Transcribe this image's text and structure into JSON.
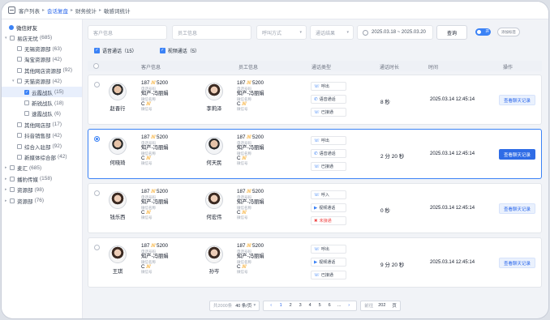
{
  "topnav": {
    "tabs": [
      "客户列表",
      "会话复盘",
      "财务统计",
      "敏感词统计"
    ],
    "active": 1
  },
  "sidebar": {
    "header": "微信好友",
    "items": [
      {
        "label": "易店无忧",
        "count": "(685)",
        "level": 0,
        "checked": false
      },
      {
        "label": "无锡资源部",
        "count": "(63)",
        "level": 1,
        "checked": false
      },
      {
        "label": "淘宝资源部",
        "count": "(42)",
        "level": 1,
        "checked": false
      },
      {
        "label": "其他网店资源部",
        "count": "(92)",
        "level": 1,
        "checked": false
      },
      {
        "label": "天猫资源部",
        "count": "(42)",
        "level": 1,
        "checked": false
      },
      {
        "label": "云霞战队",
        "count": "(15)",
        "level": 2,
        "checked": true
      },
      {
        "label": "新锐战队",
        "count": "(18)",
        "level": 2,
        "checked": false
      },
      {
        "label": "速霞战队",
        "count": "(6)",
        "level": 2,
        "checked": false
      },
      {
        "label": "其他网店部",
        "count": "(17)",
        "level": 1,
        "checked": false
      },
      {
        "label": "抖音销售部",
        "count": "(42)",
        "level": 1,
        "checked": false
      },
      {
        "label": "综合入驻部",
        "count": "(92)",
        "level": 1,
        "checked": false
      },
      {
        "label": "新媒体综合部",
        "count": "(42)",
        "level": 1,
        "checked": false
      },
      {
        "label": "麦汇",
        "count": "(685)",
        "level": 0,
        "checked": false
      },
      {
        "label": "播豹传媒",
        "count": "(158)",
        "level": 0,
        "checked": false
      },
      {
        "label": "资源部",
        "count": "(98)",
        "level": 0,
        "checked": false
      },
      {
        "label": "资源部",
        "count": "(76)",
        "level": 0,
        "checked": false
      }
    ]
  },
  "filters": {
    "customer_placeholder": "客户信息",
    "employee_placeholder": "员工信息",
    "call_type_placeholder": "呼叫方式",
    "call_result_placeholder": "通话结果",
    "date_range": "2025.03.18  ~  2025.03.20",
    "search_label": "查询",
    "toggle_label": "开",
    "tag_label": "添加标签"
  },
  "checks": [
    {
      "label": "语音通话（15）",
      "checked": true
    },
    {
      "label": "视频通话（5）",
      "checked": true
    }
  ],
  "table": {
    "headers": [
      "客户信息",
      "员工信息",
      "通话类型",
      "通话时长",
      "时间",
      "操作"
    ],
    "rows": [
      {
        "customer": "赵晋行",
        "employee": "李莉泽",
        "cust_phone": "187",
        "cust_mask": "////",
        "cust_tail": "5200",
        "cust_phone_note": "电话号码",
        "cust_wechat": "知产-冯丽娟",
        "cust_wechat_note": "微信名称",
        "cust_id": "C",
        "cust_id_mask": "////",
        "cust_id_note": "微信号",
        "emp_phone": "187",
        "emp_mask": "////",
        "emp_tail": "5200",
        "emp_phone_note": "电话号码",
        "emp_wechat": "知产-冯丽娟",
        "emp_wechat_note": "微信名称",
        "emp_id": "C",
        "emp_id_mask": "////",
        "emp_id_note": "微信号",
        "types": [
          {
            "label": "呼出",
            "icon": "☏",
            "red": false
          },
          {
            "label": "语音通话",
            "icon": "✆",
            "red": false
          },
          {
            "label": "已接通",
            "icon": "☏",
            "red": false
          }
        ],
        "duration": "8 秒",
        "time": "2025.03.14   12:45:14",
        "action": "查看聊天记录",
        "selected": false,
        "female_cust": false,
        "female_emp": true
      },
      {
        "customer": "何晓琦",
        "employee": "何天民",
        "cust_phone": "187",
        "cust_mask": "////",
        "cust_tail": "5200",
        "cust_phone_note": "电话号码",
        "cust_wechat": "知产-冯丽娟",
        "cust_wechat_note": "微信名称",
        "cust_id": "C",
        "cust_id_mask": "////",
        "cust_id_note": "微信号",
        "emp_phone": "187",
        "emp_mask": "////",
        "emp_tail": "5200",
        "emp_phone_note": "电话号码",
        "emp_wechat": "知产-冯丽娟",
        "emp_wechat_note": "微信名称",
        "emp_id": "C",
        "emp_id_mask": "////",
        "emp_id_note": "微信号",
        "types": [
          {
            "label": "呼出",
            "icon": "☏",
            "red": false
          },
          {
            "label": "语音通话",
            "icon": "✆",
            "red": false
          },
          {
            "label": "已接通",
            "icon": "☏",
            "red": false
          }
        ],
        "duration": "2 分 20 秒",
        "time": "2025.03.14   12:45:14",
        "action": "查看聊天记录",
        "selected": true,
        "female_cust": false,
        "female_emp": false
      },
      {
        "customer": "钱乐西",
        "employee": "何宏伟",
        "cust_phone": "187",
        "cust_mask": "////",
        "cust_tail": "5200",
        "cust_phone_note": "电话号码",
        "cust_wechat": "知产-冯丽娟",
        "cust_wechat_note": "微信名称",
        "cust_id": "C",
        "cust_id_mask": "////",
        "cust_id_note": "微信号",
        "emp_phone": "187",
        "emp_mask": "////",
        "emp_tail": "5200",
        "emp_phone_note": "电话号码",
        "emp_wechat": "知产-冯丽娟",
        "emp_wechat_note": "微信名称",
        "emp_id": "C",
        "emp_id_mask": "////",
        "emp_id_note": "微信号",
        "types": [
          {
            "label": "呼入",
            "icon": "☏",
            "red": false
          },
          {
            "label": "视频通话",
            "icon": "▶",
            "red": false
          },
          {
            "label": "未接通",
            "icon": "✖",
            "red": true
          }
        ],
        "duration": "0 秒",
        "time": "2025.03.14   12:45:14",
        "action": "查看聊天记录",
        "selected": false,
        "female_cust": true,
        "female_emp": true
      },
      {
        "customer": "王琪",
        "employee": "孙岑",
        "cust_phone": "187",
        "cust_mask": "////",
        "cust_tail": "5200",
        "cust_phone_note": "电话号码",
        "cust_wechat": "知产-冯丽娟",
        "cust_wechat_note": "微信名称",
        "cust_id": "C",
        "cust_id_mask": "////",
        "cust_id_note": "微信号",
        "emp_phone": "187",
        "emp_mask": "////",
        "emp_tail": "5200",
        "emp_phone_note": "电话号码",
        "emp_wechat": "知产-冯丽娟",
        "emp_wechat_note": "微信名称",
        "emp_id": "C",
        "emp_id_mask": "////",
        "emp_id_note": "微信号",
        "types": [
          {
            "label": "呼出",
            "icon": "☏",
            "red": false
          },
          {
            "label": "视频通话",
            "icon": "▶",
            "red": false
          },
          {
            "label": "已接通",
            "icon": "☏",
            "red": false
          }
        ],
        "duration": "9 分 20 秒",
        "time": "2025.03.14   12:45:14",
        "action": "查看聊天记录",
        "selected": false,
        "female_cust": true,
        "female_emp": true
      }
    ]
  },
  "pagination": {
    "total": "共2000条",
    "per_page": "40 条/页",
    "pages": [
      "1",
      "2",
      "3",
      "4",
      "5",
      "6",
      "..."
    ],
    "prev": "‹",
    "next": "›",
    "goto_label": "前往",
    "goto_value": "202",
    "page_unit": "页"
  },
  "colors": {
    "accent": "#2f6ce6",
    "selected_border": "#3b82f6",
    "missed": "#ef4444",
    "mask": "#f59e0b"
  }
}
